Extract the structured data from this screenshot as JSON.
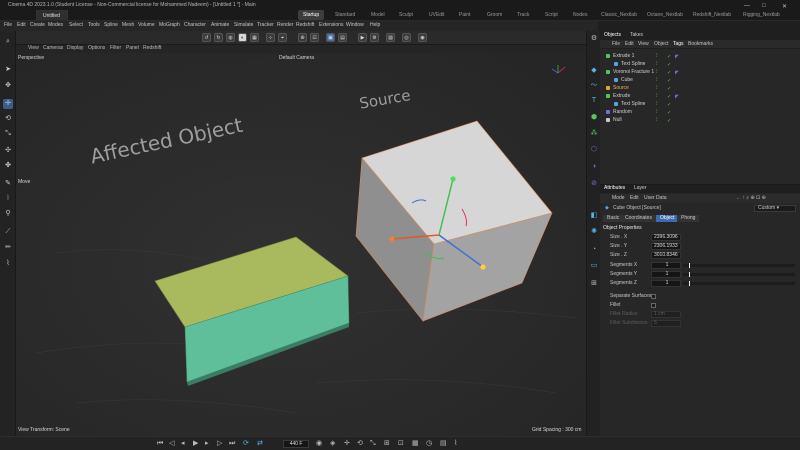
{
  "window": {
    "title": "Cinema 4D 2023.1.0 (Student License - Non-Commercial license for Mohammed Nadeem) - [Untitled 1 *] - Main",
    "doc_tab": "Untitled 1 *",
    "controls": {
      "minimize": "—",
      "maximize": "□",
      "close": "✕"
    }
  },
  "layouts": [
    "Startup",
    "Standard",
    "Model",
    "Sculpt",
    "UVEdit",
    "Paint",
    "Groom",
    "Track",
    "Script",
    "Nodes",
    "Classic_Nextlab",
    "Octane_Nextlab",
    "Redshift_Nextlab",
    "Rigging_Nextlab"
  ],
  "active_layout": "Startup",
  "menu": [
    "File",
    "Edit",
    "Create",
    "Modes",
    "Select",
    "Tools",
    "Spline",
    "Mesh",
    "Volume",
    "MoGraph",
    "Character",
    "Animate",
    "Simulate",
    "Tracker",
    "Render",
    "Redshift",
    "Extensions",
    "Window",
    "Help"
  ],
  "viewport_menu": [
    "View",
    "Cameras",
    "Display",
    "Options",
    "Filter",
    "Panel",
    "Redshift"
  ],
  "viewport": {
    "name": "Perspective",
    "camera": "Default Camera",
    "tool_label": "Move",
    "status_left": "View Transform: Scene",
    "status_right": "Grid Spacing : 300 cm",
    "text_affected": "Affected Object",
    "text_source": "Source"
  },
  "playback": {
    "frame": "440 F"
  },
  "objects_panel": {
    "tabs": [
      "Objects",
      "Takes"
    ],
    "menu": [
      "File",
      "Edit",
      "View",
      "Object",
      "Tags",
      "Bookmarks"
    ],
    "items": [
      {
        "name": "Extrude 1",
        "color": "#57c65a",
        "indent": 0
      },
      {
        "name": "Text Spline",
        "color": "#57a3e0",
        "indent": 1
      },
      {
        "name": "Voronoi Fracture 1",
        "color": "#57c65a",
        "indent": 0
      },
      {
        "name": "Cube",
        "color": "#57a3e0",
        "indent": 1
      },
      {
        "name": "Source",
        "color": "#e6a33a",
        "indent": 0
      },
      {
        "name": "Extrude",
        "color": "#57c65a",
        "indent": 0
      },
      {
        "name": "Text Spline",
        "color": "#57a3e0",
        "indent": 1
      },
      {
        "name": "Random",
        "color": "#7a6fd6",
        "indent": 0
      },
      {
        "name": "Null",
        "color": "#c9c9c9",
        "indent": 0
      }
    ]
  },
  "attributes_panel": {
    "tabs": [
      "Attributes",
      "Layer"
    ],
    "menu": [
      "Mode",
      "Edit",
      "User Data"
    ],
    "mode_select": "Custom",
    "object_title": "Cube Object [Source]",
    "sub_tabs": [
      "Basic",
      "Coordinates",
      "Object",
      "Phong"
    ],
    "active_sub_tab": "Object",
    "section": "Object Properties",
    "fields": [
      {
        "label": "Size . X",
        "value": "2396.3096"
      },
      {
        "label": "Size . Y",
        "value": "2306.1933"
      },
      {
        "label": "Size . Z",
        "value": "3010.8346"
      }
    ],
    "segments": [
      {
        "label": "Segments X",
        "value": "1",
        "fraction": 0.05
      },
      {
        "label": "Segments Y",
        "value": "1",
        "fraction": 0.05
      },
      {
        "label": "Segments Z",
        "value": "1",
        "fraction": 0.05
      }
    ],
    "checks": [
      {
        "label": "Separate Surfaces"
      },
      {
        "label": "Fillet"
      }
    ],
    "dim_rows": [
      {
        "label": "Fillet Radius",
        "value": "1 cm"
      },
      {
        "label": "Fillet Subdivision",
        "value": "5"
      }
    ]
  },
  "colors": {
    "plane_top": "#a9b95e",
    "plane_bottom": "#5fbf9a",
    "cube_top": "#d6d6d6",
    "cube_side": "#9a9a9a",
    "accent": "#3c6bb0"
  }
}
